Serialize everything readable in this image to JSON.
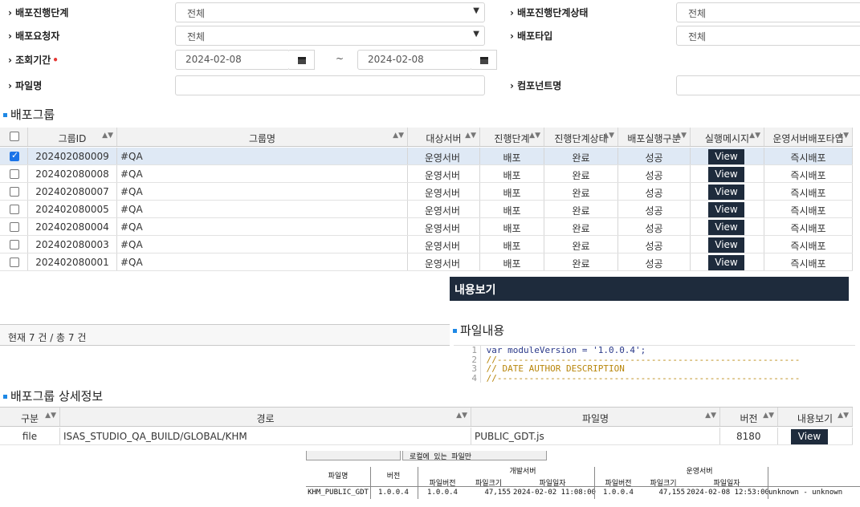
{
  "filters": {
    "stage_label": "배포진행단계",
    "stage_value": "전체",
    "stage_status_label": "배포진행단계상태",
    "stage_status_value": "전체",
    "requester_label": "배포요청자",
    "requester_value": "전체",
    "type_label": "배포타입",
    "type_value": "전체",
    "period_label": "조회기간",
    "required_mark": "•",
    "date_from": "2024-02-08",
    "date_to": "2024-02-08",
    "tilde": "~",
    "filename_label": "파일명",
    "filename_value": "",
    "component_label": "컴포넌트명",
    "component_value": ""
  },
  "group_section": {
    "title": "배포그룹",
    "headers": [
      "그룹ID",
      "그룹명",
      "대상서버",
      "진행단계",
      "진행단계상태",
      "배포실행구분",
      "실행메시지",
      "운영서버배포타입"
    ],
    "view_label": "View",
    "rows": [
      {
        "id": "202402080009",
        "name": "#QA",
        "server": "운영서버",
        "stage": "배포",
        "status": "완료",
        "result": "성공",
        "deploy_type": "즉시배포",
        "checked": true
      },
      {
        "id": "202402080008",
        "name": "#QA",
        "server": "운영서버",
        "stage": "배포",
        "status": "완료",
        "result": "성공",
        "deploy_type": "즉시배포",
        "checked": false
      },
      {
        "id": "202402080007",
        "name": "#QA",
        "server": "운영서버",
        "stage": "배포",
        "status": "완료",
        "result": "성공",
        "deploy_type": "즉시배포",
        "checked": false
      },
      {
        "id": "202402080005",
        "name": "#QA",
        "server": "운영서버",
        "stage": "배포",
        "status": "완료",
        "result": "성공",
        "deploy_type": "즉시배포",
        "checked": false
      },
      {
        "id": "202402080004",
        "name": "#QA",
        "server": "운영서버",
        "stage": "배포",
        "status": "완료",
        "result": "성공",
        "deploy_type": "즉시배포",
        "checked": false
      },
      {
        "id": "202402080003",
        "name": "#QA",
        "server": "운영서버",
        "stage": "배포",
        "status": "완료",
        "result": "성공",
        "deploy_type": "즉시배포",
        "checked": false
      },
      {
        "id": "202402080001",
        "name": "#QA",
        "server": "운영서버",
        "stage": "배포",
        "status": "완료",
        "result": "성공",
        "deploy_type": "즉시배포",
        "checked": false
      }
    ],
    "footer": "현재 7 건 / 총 7 건"
  },
  "popup": {
    "title": "내용보기",
    "subtitle": "파일내용",
    "code_lines": [
      {
        "n": "1",
        "text": "var moduleVersion = '1.0.0.4';"
      },
      {
        "n": "2",
        "text": "//---------------------------------------------------------"
      },
      {
        "n": "3",
        "text": "//    DATE        AUTHOR     DESCRIPTION"
      },
      {
        "n": "4",
        "text": "//---------------------------------------------------------"
      }
    ]
  },
  "detail_section": {
    "title": "배포그룹 상세정보",
    "headers": [
      "구분",
      "경로",
      "파일명",
      "버전",
      "내용보기"
    ],
    "row": {
      "kind": "file",
      "path": "ISAS_STUDIO_QA_BUILD/GLOBAL/KHM",
      "filename": "PUBLIC_GDT.js",
      "version": "8180",
      "view_label": "View"
    }
  },
  "compare": {
    "tab_label": "로컬에 있는 파일만",
    "dev_server": "개발서버",
    "prod_server": "운영서버",
    "h_filename": "파일명",
    "h_version": "버전",
    "h_file_version": "파일버전",
    "h_file_size": "파일크기",
    "h_file_date": "파일일자",
    "row": {
      "filename": "KHM_PUBLIC_GDT",
      "version": "1.0.0.4",
      "dev_file_version": "1.0.0.4",
      "dev_size": "47,155",
      "dev_date": "2024-02-02 11:08:00",
      "prod_file_version": "1.0.0.4",
      "prod_size": "47,155",
      "prod_date": "2024-02-08 12:53:00",
      "note": "unknown - unknown"
    }
  }
}
